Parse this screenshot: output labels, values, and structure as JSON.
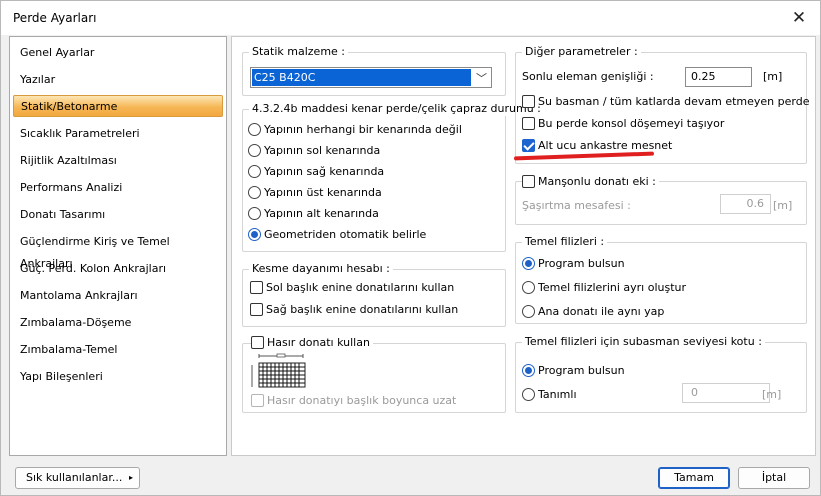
{
  "window": {
    "title": "Perde Ayarları"
  },
  "sidebar": {
    "items": [
      {
        "label": "Genel Ayarlar",
        "active": false
      },
      {
        "label": "Yazılar",
        "active": false
      },
      {
        "label": "Statik/Betonarme",
        "active": true
      },
      {
        "label": "Sıcaklık Parametreleri",
        "active": false
      },
      {
        "label": "Rijitlik Azaltılması",
        "active": false
      },
      {
        "label": "Performans Analizi",
        "active": false
      },
      {
        "label": "Donatı Tasarımı",
        "active": false
      },
      {
        "label": "Güçlendirme Kiriş ve Temel Ankrajları",
        "active": false
      },
      {
        "label": "Güç. Perd. Kolon Ankrajları",
        "active": false
      },
      {
        "label": "Mantolama Ankrajları",
        "active": false
      },
      {
        "label": "Zımbalama-Döşeme",
        "active": false
      },
      {
        "label": "Zımbalama-Temel",
        "active": false
      },
      {
        "label": "Yapı Bileşenleri",
        "active": false
      }
    ]
  },
  "statik": {
    "title": "Statik malzeme :",
    "material": "C25 B420C"
  },
  "kenar": {
    "title": "4.3.2.4b maddesi kenar perde/çelik çapraz durumu :",
    "options": [
      {
        "label": "Yapının herhangi bir kenarında değil",
        "selected": false
      },
      {
        "label": "Yapının sol kenarında",
        "selected": false
      },
      {
        "label": "Yapının sağ kenarında",
        "selected": false
      },
      {
        "label": "Yapının üst kenarında",
        "selected": false
      },
      {
        "label": "Yapının alt kenarında",
        "selected": false
      },
      {
        "label": "Geometriden otomatik belirle",
        "selected": true
      }
    ]
  },
  "kesme": {
    "title": "Kesme dayanımı hesabı :",
    "options": [
      {
        "label": "Sol başlık enine donatılarını kullan",
        "checked": false
      },
      {
        "label": "Sağ başlık enine donatılarını kullan",
        "checked": false
      }
    ]
  },
  "hasir": {
    "title": "Hasır donatı kullan",
    "checked": false,
    "extend_label": "Hasır donatıyı başlık boyunca uzat"
  },
  "diger": {
    "title": "Diğer parametreler :",
    "fe_label": "Sonlu eleman genişliği :",
    "fe_value": "0.25",
    "fe_unit": "[m]",
    "opt_basman": "Su basman / tüm katlarda devam etmeyen perde",
    "opt_konsol": "Bu perde konsol döşemeyi taşıyor",
    "opt_altucu": "Alt ucu ankastre mesnet"
  },
  "mansonlu": {
    "title": "Manşonlu donatı eki :",
    "shift_label": "Şaşırtma mesafesi :",
    "shift_value": "0.6",
    "shift_unit": "[m]"
  },
  "temel": {
    "title": "Temel filizleri :",
    "options": [
      {
        "label": "Program bulsun",
        "selected": true
      },
      {
        "label": "Temel filizlerini ayrı oluştur",
        "selected": false
      },
      {
        "label": "Ana donatı ile aynı yap",
        "selected": false
      }
    ]
  },
  "subasman": {
    "title": "Temel filizleri için subasman seviyesi kotu :",
    "opt_program": "Program bulsun",
    "opt_tanimli": "Tanımlı",
    "value": "0",
    "unit": "[m]"
  },
  "footer": {
    "frequent": "Sık kullanılanlar...",
    "ok": "Tamam",
    "cancel": "İptal"
  },
  "colors": {
    "accent": "#1e62c8",
    "highlight": "#f6b756",
    "annotation": "#e02020"
  }
}
